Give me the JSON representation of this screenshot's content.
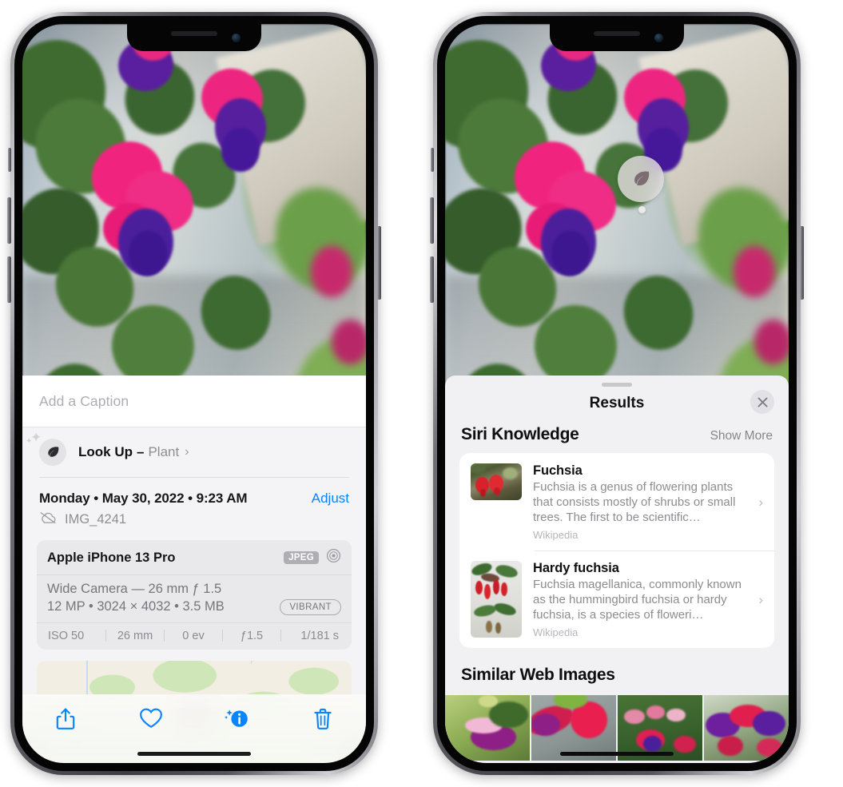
{
  "left_phone": {
    "name": "photos-detail-view",
    "caption": {
      "placeholder": "Add a Caption",
      "value": ""
    },
    "lookup": {
      "title": "Look Up",
      "dash": "–",
      "kind": "Plant",
      "icon": "leaf-icon",
      "chevron": "›",
      "sparkle": "✦"
    },
    "date_row": {
      "date": "Monday • May 30, 2022 • 9:23 AM",
      "adjust_label": "Adjust"
    },
    "file_row": {
      "icon": "icloud-slash-icon",
      "filename": "IMG_4241"
    },
    "exif": {
      "device": "Apple iPhone 13 Pro",
      "format_badge": "JPEG",
      "aperture_icon": "aperture-icon",
      "lens": "Wide Camera — 26 mm ƒ 1.5",
      "specs": "12 MP • 3024 × 4032 • 3.5 MB",
      "style_badge": "VIBRANT",
      "stats": [
        "ISO 50",
        "26 mm",
        "0 ev",
        "ƒ1.5",
        "1/181 s"
      ]
    },
    "map": {
      "name": "location-map-card"
    },
    "toolbar": [
      {
        "name": "share-button",
        "icon": "share-icon"
      },
      {
        "name": "favorite-button",
        "icon": "heart-icon"
      },
      {
        "name": "info-button",
        "icon": "info-sparkle-icon"
      },
      {
        "name": "delete-button",
        "icon": "trash-icon"
      }
    ],
    "accent_color": "#0a84ff"
  },
  "right_phone": {
    "name": "visual-look-up-results",
    "vlu_badge": {
      "icon": "leaf-icon"
    },
    "sheet": {
      "title": "Results",
      "close_icon": "close-icon",
      "sections": [
        {
          "name": "siri-knowledge",
          "title": "Siri Knowledge",
          "action": "Show More",
          "items": [
            {
              "title": "Fuchsia",
              "description": "Fuchsia is a genus of flowering plants that consists mostly of shrubs or small trees. The first to be scientific…",
              "source": "Wikipedia",
              "thumb": "fuchsia-red-thumb",
              "chevron": "›"
            },
            {
              "title": "Hardy fuchsia",
              "description": "Fuchsia magellanica, commonly known as the hummingbird fuchsia or hardy fuchsia, is a species of floweri…",
              "source": "Wikipedia",
              "thumb": "hardy-fuchsia-thumb",
              "chevron": "›"
            }
          ]
        },
        {
          "name": "similar-web-images",
          "title": "Similar Web Images",
          "items": [
            {
              "name": "similar-image-1"
            },
            {
              "name": "similar-image-2"
            },
            {
              "name": "similar-image-3"
            },
            {
              "name": "similar-image-4"
            }
          ]
        }
      ]
    }
  }
}
